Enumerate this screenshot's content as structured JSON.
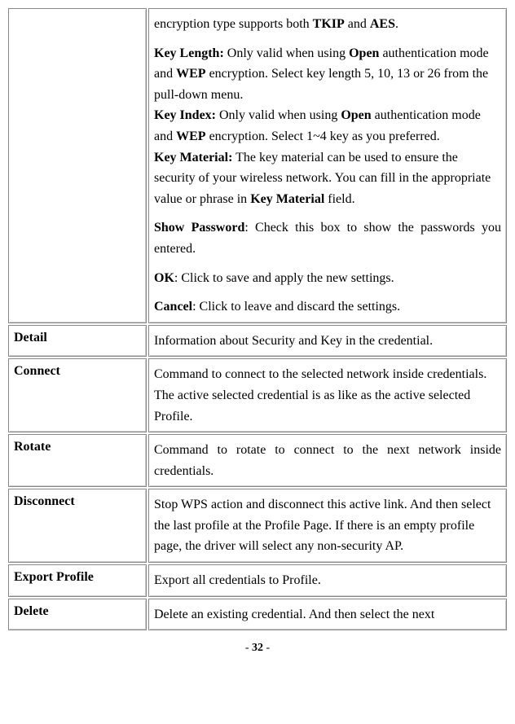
{
  "row0": {
    "label": "",
    "p1_pre": "encryption type supports both ",
    "p1_b1": "TKIP",
    "p1_mid": " and ",
    "p1_b2": "AES",
    "p1_post": ".",
    "p2_b1": "Key Length:",
    "p2_t1": " Only valid when using ",
    "p2_b2": "Open",
    "p2_t2": " authentication mode and ",
    "p2_b3": "WEP",
    "p2_t3": " encryption. Select key length 5, 10, 13 or 26 from the pull-down menu.",
    "p3_b1": "Key Index:",
    "p3_t1": " Only valid when using ",
    "p3_b2": "Open",
    "p3_t2": " authentication mode and ",
    "p3_b3": "WEP",
    "p3_t3": " encryption. Select 1~4 key as you preferred.",
    "p4_b1": "Key Material:",
    "p4_t1": " The key material can be used to ensure the security of your wireless network. You can fill in the appropriate value or phrase in ",
    "p4_b2": "Key Material",
    "p4_t2": " field.",
    "p5_b1": "Show Password",
    "p5_t1": ": Check this box to show the passwords you entered.",
    "p6_b1": "OK",
    "p6_t1": ": Click to save and apply the new settings.",
    "p7_b1": "Cancel",
    "p7_t1": ": Click to leave and discard the settings."
  },
  "rows": [
    {
      "label": "Detail",
      "desc": "Information about Security and Key in the credential."
    },
    {
      "label": "Connect",
      "desc": "Command to connect to the selected network inside credentials. The active selected credential is as like as the active selected Profile."
    },
    {
      "label": "Rotate",
      "desc": "Command to rotate to connect to the next network inside credentials."
    },
    {
      "label": "Disconnect",
      "desc": "Stop WPS action and disconnect this active link. And then select the last profile at the Profile Page. If there is an empty profile page, the driver will select any non-security AP."
    },
    {
      "label": "Export Profile",
      "desc": "Export all credentials to Profile."
    },
    {
      "label": "Delete",
      "desc": "Delete an existing credential. And then select the next"
    }
  ],
  "pageNumber": "32"
}
